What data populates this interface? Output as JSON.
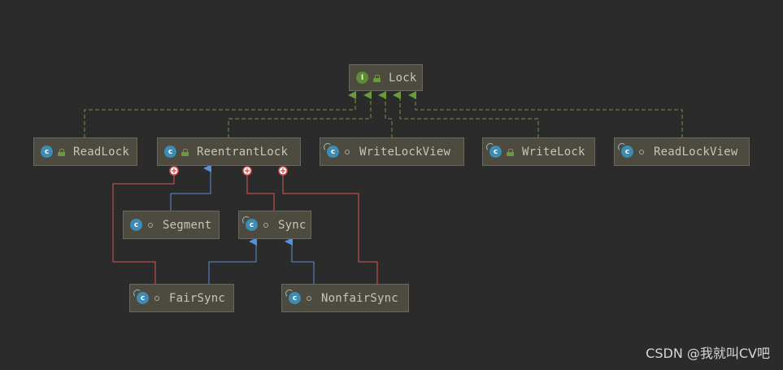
{
  "diagram": {
    "nodes": [
      {
        "id": "lock",
        "label": "Lock",
        "kind": "interface",
        "icon": "interface-icon",
        "visibility": "public"
      },
      {
        "id": "readlock",
        "label": "ReadLock",
        "kind": "class",
        "icon": "class-icon",
        "visibility": "public"
      },
      {
        "id": "reentrantlock",
        "label": "ReentrantLock",
        "kind": "class",
        "icon": "class-icon",
        "visibility": "public"
      },
      {
        "id": "writelockview",
        "label": "WriteLockView",
        "kind": "static-class",
        "icon": "static-class-icon",
        "visibility": "package"
      },
      {
        "id": "writelock",
        "label": "WriteLock",
        "kind": "static-class",
        "icon": "static-class-icon",
        "visibility": "public"
      },
      {
        "id": "readlockview",
        "label": "ReadLockView",
        "kind": "static-class",
        "icon": "static-class-icon",
        "visibility": "package"
      },
      {
        "id": "segment",
        "label": "Segment",
        "kind": "class",
        "icon": "class-icon",
        "visibility": "package"
      },
      {
        "id": "sync",
        "label": "Sync",
        "kind": "abstract-class",
        "icon": "static-class-icon",
        "visibility": "package"
      },
      {
        "id": "fairsync",
        "label": "FairSync",
        "kind": "static-class",
        "icon": "static-class-icon",
        "visibility": "package"
      },
      {
        "id": "nonfairsync",
        "label": "NonfairSync",
        "kind": "static-class",
        "icon": "static-class-icon",
        "visibility": "package"
      }
    ],
    "edges": [
      {
        "from": "readlock",
        "to": "lock",
        "type": "implements"
      },
      {
        "from": "reentrantlock",
        "to": "lock",
        "type": "implements"
      },
      {
        "from": "writelockview",
        "to": "lock",
        "type": "implements"
      },
      {
        "from": "writelock",
        "to": "lock",
        "type": "implements"
      },
      {
        "from": "readlockview",
        "to": "lock",
        "type": "implements"
      },
      {
        "from": "segment",
        "to": "reentrantlock",
        "type": "extends"
      },
      {
        "from": "fairsync",
        "to": "sync",
        "type": "extends"
      },
      {
        "from": "nonfairsync",
        "to": "sync",
        "type": "extends"
      },
      {
        "from": "fairsync",
        "to": "reentrantlock",
        "type": "inner-class"
      },
      {
        "from": "sync",
        "to": "reentrantlock",
        "type": "inner-class"
      },
      {
        "from": "nonfairsync",
        "to": "reentrantlock",
        "type": "inner-class"
      }
    ],
    "colors": {
      "background": "#2b2b2b",
      "implements": "#6a9a3c",
      "extends": "#5a8fd6",
      "inner_class": "#d95656",
      "node_fill": "#4d4b40",
      "text": "#c9c5b3"
    }
  },
  "watermark": "CSDN @我就叫CV吧"
}
